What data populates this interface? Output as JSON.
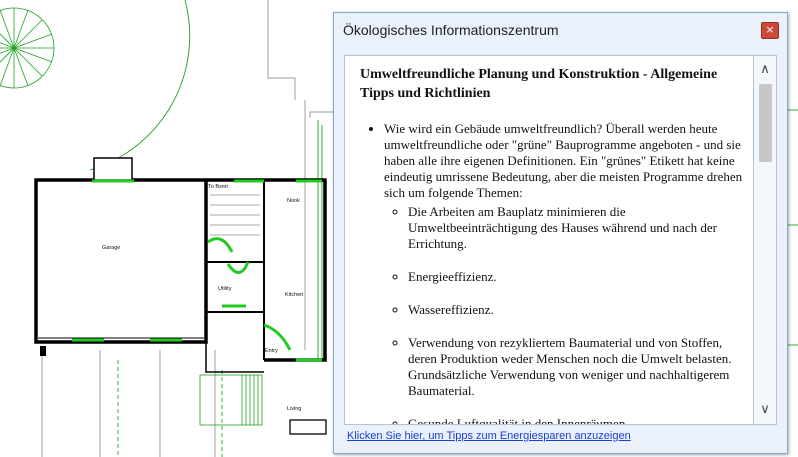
{
  "cad": {
    "labels": {
      "garage": "Garage",
      "to_bsmt": "To Bsmt",
      "nook": "Nook",
      "utility": "Utility",
      "kitchen": "Kitchen",
      "entry": "Entry",
      "living": "Living"
    }
  },
  "dialog": {
    "title": "Ökologisches Informationszentrum",
    "close_symbol": "×",
    "heading": "Umweltfreundliche Planung und Konstruktion - Allgemeine Tipps und Richtlinien",
    "intro": "Wie wird ein Gebäude umweltfreundlich? Überall werden heute umweltfreundliche oder \"grüne\" Bauprogramme angeboten - und sie haben alle ihre eigenen Definitionen. Ein \"grünes\" Etikett hat keine eindeutig umrissene Bedeutung, aber die meisten Programme drehen sich um folgende Themen:",
    "topics": [
      "Die Arbeiten am Bauplatz minimieren die Umweltbeeinträchtigung des Hauses während und nach der Errichtung.",
      "Energieeffizienz.",
      "Wassereffizienz.",
      "Verwendung von rezykliertem Baumaterial und von Stoffen, deren Produktion weder Menschen noch die Umwelt belasten. Grundsätzliche Verwendung von weniger und nachhaltigerem Baumaterial.",
      "Gesunde Luftqualität in den Innenräumen."
    ],
    "link": "Klicken Sie hier, um Tipps zum Energiesparen anzuzeigen",
    "scroll_up": "∧",
    "scroll_down": "∨"
  }
}
